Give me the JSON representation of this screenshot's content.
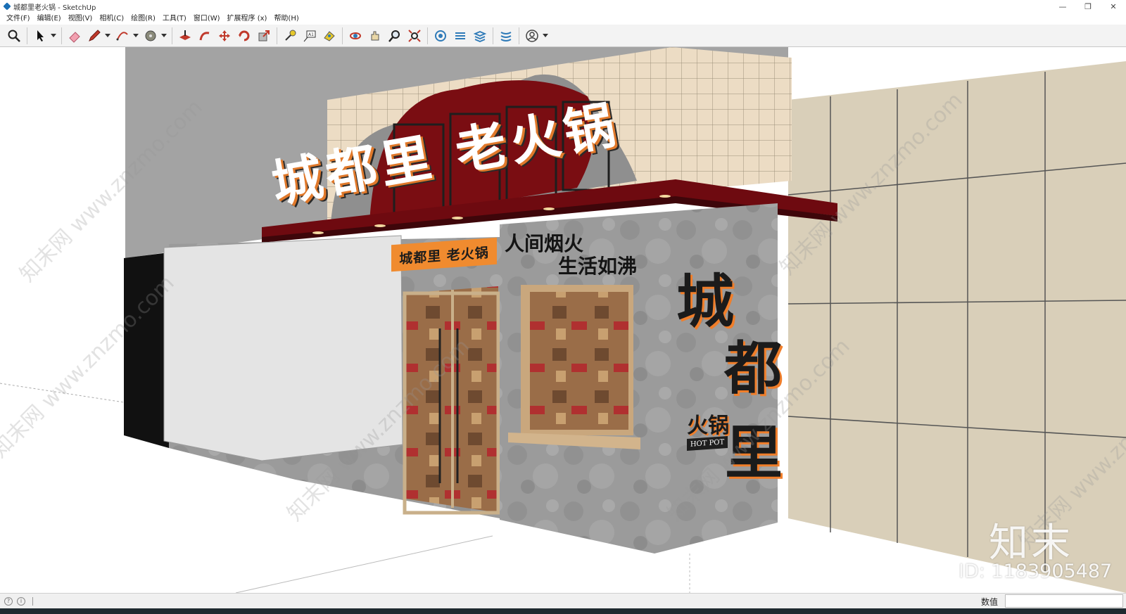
{
  "window": {
    "title": "城都里老火锅 - SketchUp"
  },
  "menu": [
    {
      "label": "文件(F)"
    },
    {
      "label": "编辑(E)"
    },
    {
      "label": "视图(V)"
    },
    {
      "label": "相机(C)"
    },
    {
      "label": "绘图(R)"
    },
    {
      "label": "工具(T)"
    },
    {
      "label": "窗口(W)"
    },
    {
      "label": "扩展程序 (x)"
    },
    {
      "label": "帮助(H)"
    }
  ],
  "toolbar": {
    "tools": [
      "zoom-window-icon",
      "select-icon",
      "eraser-icon",
      "pencil-icon",
      "arc-icon",
      "paint-bucket-icon",
      "push-pull-icon",
      "follow-me-icon",
      "move-icon",
      "rotate-icon",
      "scale-icon",
      "tape-measure-icon",
      "text-icon",
      "paint-icon",
      "orbit-icon",
      "pan-icon",
      "zoom-icon",
      "zoom-extents-icon",
      "warehouse-icon",
      "extension-warehouse-icon",
      "layout-icon",
      "sandbox-icon",
      "account-icon"
    ]
  },
  "scene": {
    "sign_main": "城都里 老火锅",
    "sign_orange": "城都里 老火锅",
    "slogan_line1": "人间烟火",
    "slogan_line2": "生活如沸",
    "side_char1": "城",
    "side_char2": "都",
    "side_char3": "里",
    "side_hotpot_cn": "火锅",
    "side_hotpot_en": "HOT POT"
  },
  "watermark": {
    "text": "知末网 www.znzmo.com",
    "logo": "知末",
    "id_label": "ID: 1183905487"
  },
  "statusbar": {
    "measure_label": "数值",
    "measure_value": ""
  },
  "colors": {
    "canopy_red": "#7a0d12",
    "sign_orange": "#f08b2f",
    "concrete": "#9a9a9a",
    "tile_beige": "#e9dbc4"
  }
}
